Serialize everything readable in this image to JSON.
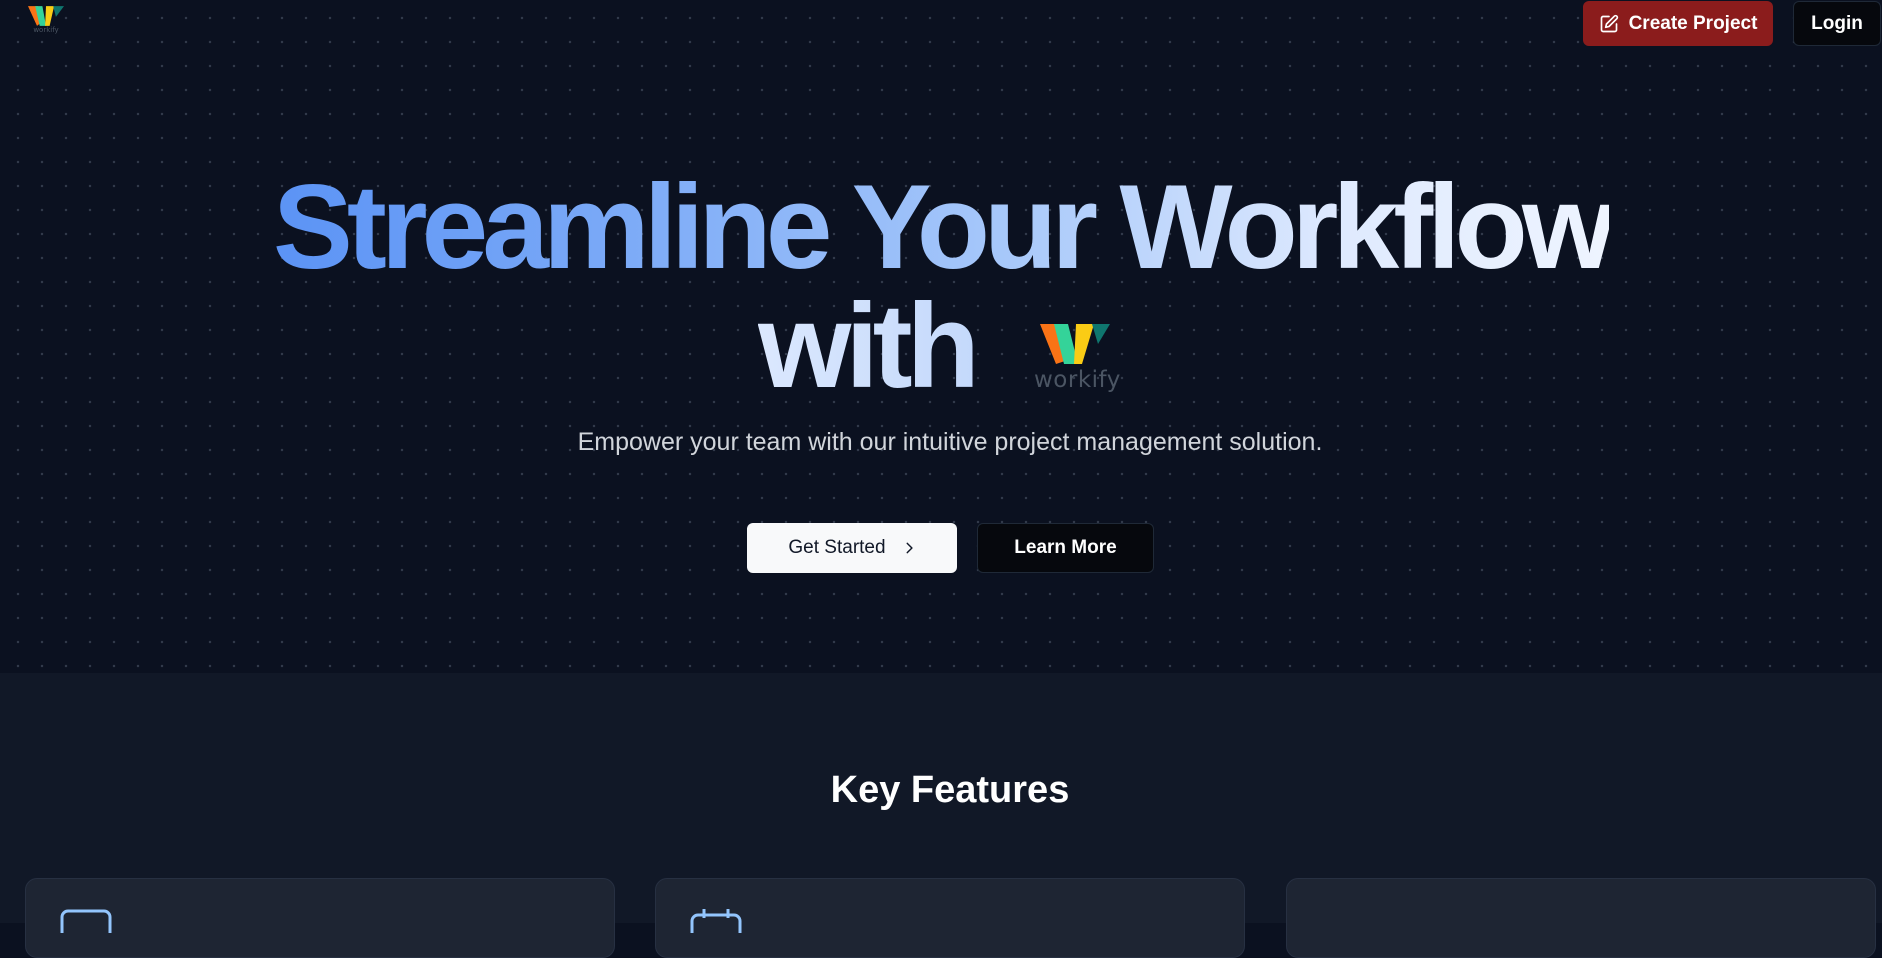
{
  "brand": {
    "wordmark": "workify",
    "logo_colors": [
      "#f97316",
      "#10b981",
      "#facc15",
      "#0f766e"
    ]
  },
  "nav": {
    "create_project_label": "Create Project",
    "login_label": "Login"
  },
  "hero": {
    "headline_line1": "Streamline Your Workflow",
    "headline_line2": "with",
    "subtitle": "Empower your team with our intuitive project management solution.",
    "get_started_label": "Get Started",
    "learn_more_label": "Learn More"
  },
  "features": {
    "title": "Key Features",
    "cards": [
      {
        "icon": "monitor-icon"
      },
      {
        "icon": "calendar-icon"
      },
      {
        "icon": "chart-icon"
      }
    ]
  },
  "colors": {
    "background": "#0b1120",
    "accent_red": "#8b1c1c",
    "gradient_start": "#5b93f5",
    "gradient_end": "#eef4ff"
  }
}
